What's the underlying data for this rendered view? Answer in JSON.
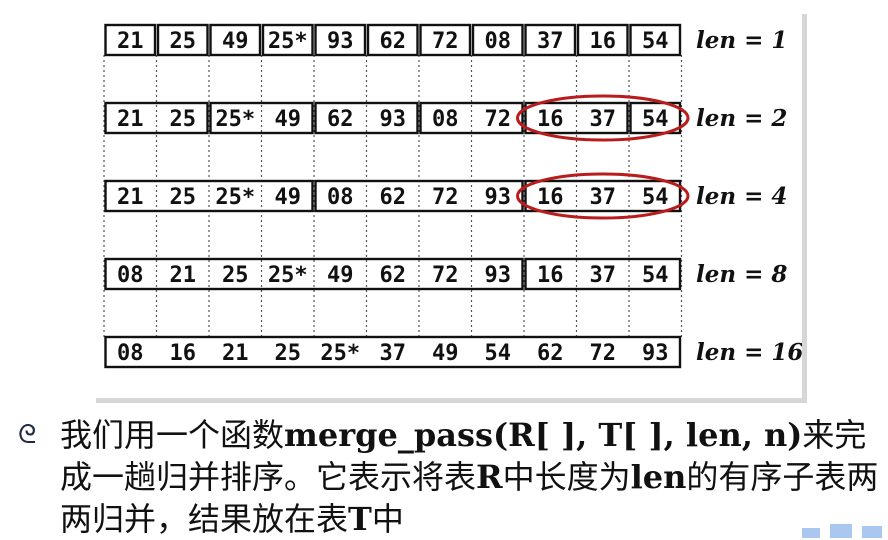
{
  "rows": [
    {
      "len_label": "len = 1",
      "groups": [
        [
          "21"
        ],
        [
          "25"
        ],
        [
          "49"
        ],
        [
          "25*"
        ],
        [
          "93"
        ],
        [
          "62"
        ],
        [
          "72"
        ],
        [
          "08"
        ],
        [
          "37"
        ],
        [
          "16"
        ],
        [
          "54"
        ]
      ]
    },
    {
      "len_label": "len = 2",
      "groups": [
        [
          "21",
          "25"
        ],
        [
          "25*",
          "49"
        ],
        [
          "62",
          "93"
        ],
        [
          "08",
          "72"
        ],
        [
          "16",
          "37"
        ],
        [
          "54"
        ]
      ]
    },
    {
      "len_label": "len = 4",
      "groups": [
        [
          "21",
          "25",
          "25*",
          "49"
        ],
        [
          "08",
          "62",
          "72",
          "93"
        ],
        [
          "16",
          "37",
          "54"
        ]
      ]
    },
    {
      "len_label": "len = 8",
      "groups": [
        [
          "08",
          "21",
          "25",
          "25*",
          "49",
          "62",
          "72",
          "93"
        ],
        [
          "16",
          "37",
          "54"
        ]
      ]
    },
    {
      "len_label": "len = 16",
      "groups": [
        [
          "08",
          "16",
          "21",
          "25",
          "25*",
          "37",
          "49",
          "54",
          "62",
          "72",
          "93"
        ]
      ]
    }
  ],
  "highlights": [
    {
      "row": 1,
      "groups": [
        4,
        5
      ],
      "color": "#b91c1c"
    },
    {
      "row": 2,
      "groups": [
        2
      ],
      "color": "#b91c1c"
    }
  ],
  "caption": {
    "bullet": "ᘓ",
    "part1": "我们用一个函数",
    "func": "merge_pass(R[ ], T[ ], len, n)",
    "part2": "来完成一趟归并排序。它表示将表",
    "r": "R",
    "part3": "中长度为",
    "len": "len",
    "part4": "的有序子表两两归并，结果放在表",
    "t": "T",
    "part5": "中"
  }
}
